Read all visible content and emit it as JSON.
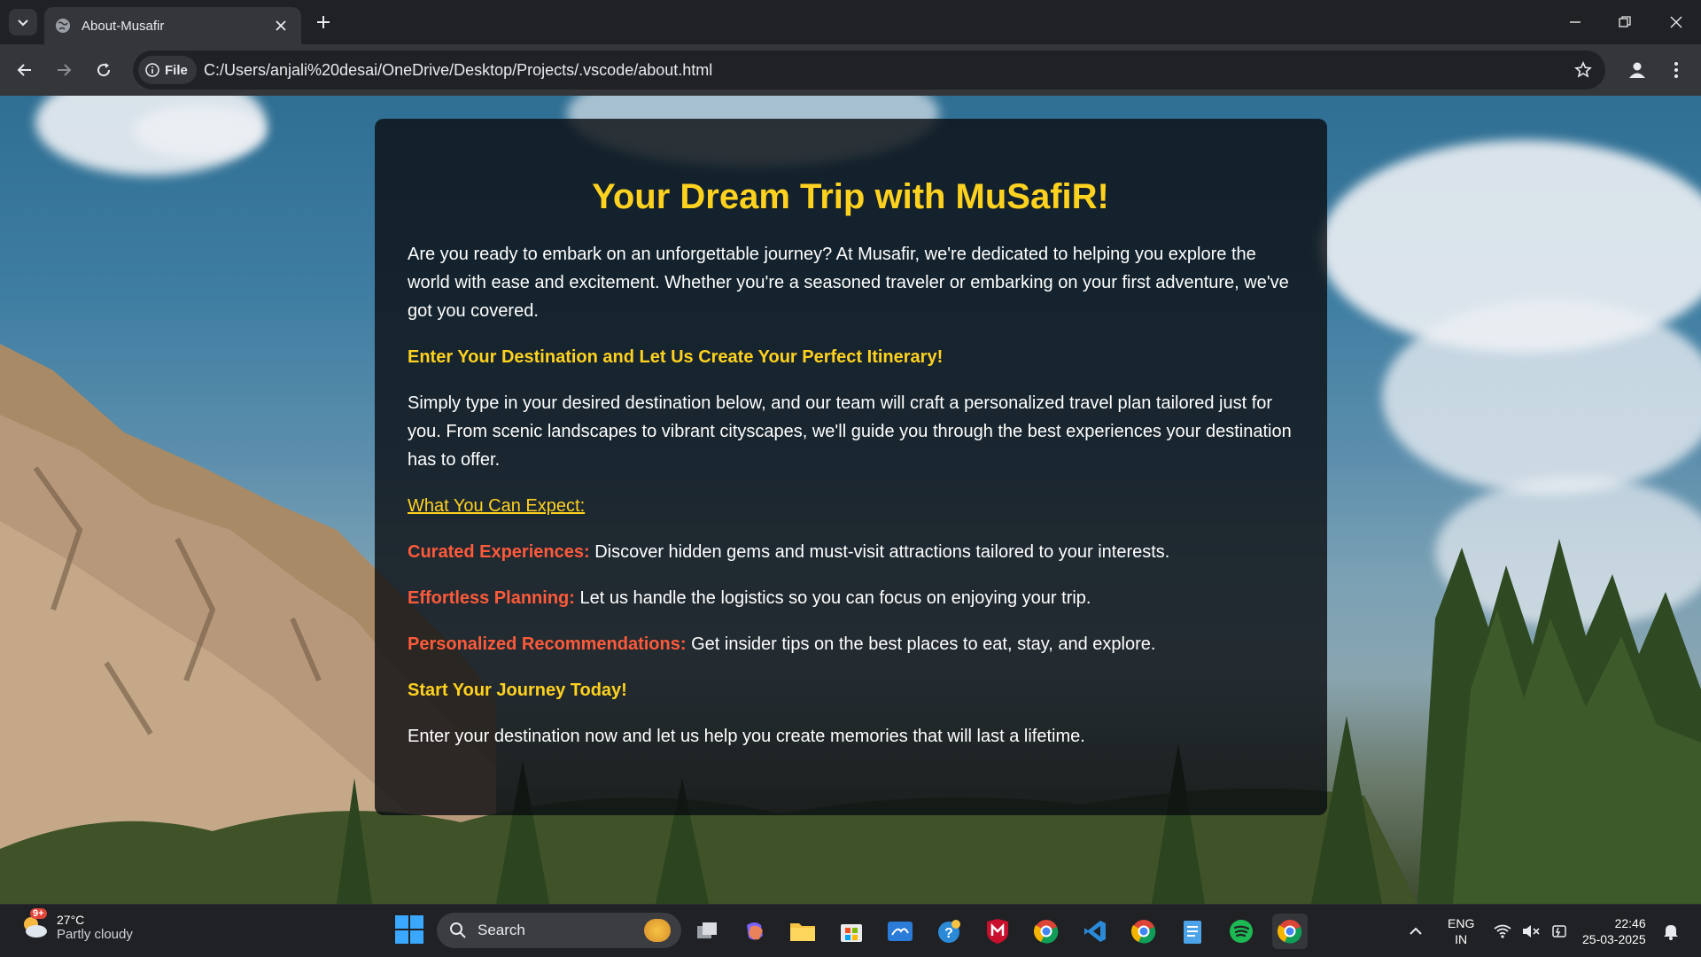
{
  "browser": {
    "tab_title": "About-Musafir",
    "chip_label": "File",
    "url": "C:/Users/anjali%20desai/OneDrive/Desktop/Projects/.vscode/about.html"
  },
  "page": {
    "heading": "Your Dream Trip with MuSafiR!",
    "intro": "Are you ready to embark on an unforgettable journey? At Musafir, we're dedicated to helping you explore the world with ease and excitement. Whether you're a seasoned traveler or embarking on your first adventure, we've got you covered.",
    "subheading": "Enter Your Destination and Let Us Create Your Perfect Itinerary!",
    "description": "Simply type in your desired destination below, and our team will craft a personalized travel plan tailored just for you. From scenic landscapes to vibrant cityscapes, we'll guide you through the best experiences your destination has to offer.",
    "expect_link": "What You Can Expect:",
    "features": [
      {
        "label": "Curated Experiences:",
        "text": " Discover hidden gems and must-visit attractions tailored to your interests."
      },
      {
        "label": "Effortless Planning:",
        "text": " Let us handle the logistics so you can focus on enjoying your trip."
      },
      {
        "label": "Personalized Recommendations:",
        "text": " Get insider tips on the best places to eat, stay, and explore."
      }
    ],
    "cta_heading": "Start Your Journey Today!",
    "closing": "Enter your destination now and let us help you create memories that will last a lifetime."
  },
  "taskbar": {
    "weather_badge": "9+",
    "temperature": "27°C",
    "condition": "Partly cloudy",
    "search_placeholder": "Search",
    "lang_line1": "ENG",
    "lang_line2": "IN",
    "time": "22:46",
    "date": "25-03-2025"
  },
  "colors": {
    "accent_yellow": "#ffd21f",
    "feature_red": "#ff5a3a",
    "card_bg": "rgba(10,12,16,0.80)"
  }
}
